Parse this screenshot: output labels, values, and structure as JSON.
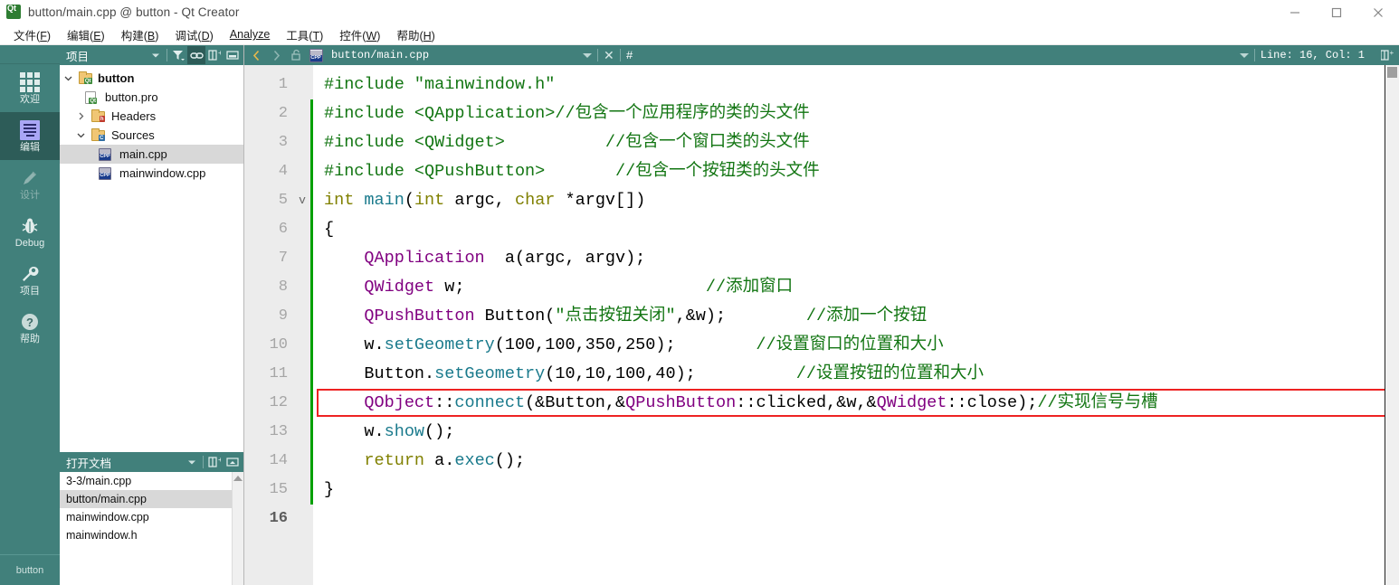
{
  "window": {
    "title": "button/main.cpp @ button - Qt Creator",
    "app_icon": "qt-icon",
    "controls": [
      {
        "name": "minimize-button",
        "glyph": "minimize"
      },
      {
        "name": "maximize-button",
        "glyph": "maximize"
      },
      {
        "name": "close-button",
        "glyph": "close"
      }
    ]
  },
  "menubar": {
    "items": [
      {
        "label": "文件",
        "accel": "F"
      },
      {
        "label": "编辑",
        "accel": "E"
      },
      {
        "label": "构建",
        "accel": "B"
      },
      {
        "label": "调试",
        "accel": "D"
      },
      {
        "label": "Analyze",
        "accel": "A",
        "accel_inline": true
      },
      {
        "label": "工具",
        "accel": "T"
      },
      {
        "label": "控件",
        "accel": "W"
      },
      {
        "label": "帮助",
        "accel": "H"
      }
    ]
  },
  "modebar": {
    "items": [
      {
        "label": "欢迎",
        "icon": "grid-icon",
        "active": false,
        "dim": false
      },
      {
        "label": "编辑",
        "icon": "document-icon",
        "active": true,
        "dim": false
      },
      {
        "label": "设计",
        "icon": "pencil-icon",
        "active": false,
        "dim": true
      },
      {
        "label": "Debug",
        "icon": "bug-icon",
        "active": false,
        "dim": false
      },
      {
        "label": "项目",
        "icon": "wrench-icon",
        "active": false,
        "dim": false
      },
      {
        "label": "帮助",
        "icon": "question-icon",
        "active": false,
        "dim": false
      }
    ],
    "bottom_label": "button"
  },
  "project_panel": {
    "title": "项目",
    "toolbar": [
      {
        "name": "project-selector-dropdown",
        "icon": "chevron-down-icon"
      },
      {
        "name": "filter-button",
        "icon": "filter-icon"
      },
      {
        "name": "link-with-editor-button",
        "icon": "link-icon",
        "active": true
      },
      {
        "name": "split-button",
        "icon": "split-icon"
      },
      {
        "name": "close-panel-button",
        "icon": "minimize-panel-icon"
      }
    ],
    "tree": [
      {
        "label": "button",
        "depth": 0,
        "arrow": "down",
        "icon": "folder-qt",
        "bold": true,
        "selected": false
      },
      {
        "label": "button.pro",
        "depth": 1,
        "arrow": "none",
        "icon": "file-qt",
        "bold": false,
        "selected": false
      },
      {
        "label": "Headers",
        "depth": 1,
        "arrow": "right",
        "icon": "folder-h",
        "bold": false,
        "selected": false
      },
      {
        "label": "Sources",
        "depth": 1,
        "arrow": "down",
        "icon": "folder-cpp",
        "bold": false,
        "selected": false
      },
      {
        "label": "main.cpp",
        "depth": 2,
        "arrow": "none",
        "icon": "file-cpp",
        "bold": false,
        "selected": true
      },
      {
        "label": "mainwindow.cpp",
        "depth": 2,
        "arrow": "none",
        "icon": "file-cpp",
        "bold": false,
        "selected": false
      }
    ]
  },
  "open_documents": {
    "title": "打开文档",
    "toolbar": [
      {
        "name": "opendocs-dropdown",
        "icon": "chevron-down-icon"
      },
      {
        "name": "opendocs-split-button",
        "icon": "split-icon"
      },
      {
        "name": "opendocs-close-button",
        "icon": "minimize-panel-icon"
      }
    ],
    "items": [
      {
        "label": "3-3/main.cpp",
        "selected": false
      },
      {
        "label": "button/main.cpp",
        "selected": true
      },
      {
        "label": "mainwindow.cpp",
        "selected": false
      },
      {
        "label": "mainwindow.h",
        "selected": false
      }
    ]
  },
  "editor_toolbar": {
    "back_icon": "chevron-left-icon",
    "forward_icon": "chevron-right-icon",
    "lock_icon": "unlock-icon",
    "file_icon": "file-cpp-icon",
    "filename": "button/main.cpp",
    "dropdown_icon": "chevron-down-icon",
    "close_icon": "close-icon",
    "symbol_label": "#",
    "line_col": "Line: 16, Col: 1",
    "split_icon": "split-icon"
  },
  "editor": {
    "gutter": {
      "numbers": [
        "1",
        "2",
        "3",
        "4",
        "5",
        "6",
        "7",
        "8",
        "9",
        "10",
        "11",
        "12",
        "13",
        "14",
        "15",
        "16"
      ],
      "current_line": 16,
      "fold_markers": {
        "5": "v"
      },
      "change_bar_lines": [
        2,
        3,
        4,
        5,
        6,
        7,
        8,
        9,
        10,
        11,
        12,
        13,
        14,
        15
      ]
    },
    "highlight_box_line": 12,
    "highlight_box_color": "#ee2222",
    "lines": [
      {
        "n": 1,
        "tokens": [
          {
            "t": "pre",
            "v": "#include "
          },
          {
            "t": "str",
            "v": "\"mainwindow.h\""
          }
        ]
      },
      {
        "n": 2,
        "tokens": [
          {
            "t": "pre",
            "v": "#include "
          },
          {
            "t": "str",
            "v": "<QApplication>"
          },
          {
            "t": "cmt",
            "v": "//包含一个应用程序的类的头文件"
          }
        ]
      },
      {
        "n": 3,
        "tokens": [
          {
            "t": "pre",
            "v": "#include "
          },
          {
            "t": "str",
            "v": "<QWidget>"
          },
          {
            "t": "cmt",
            "v": "          //包含一个窗口类的头文件"
          }
        ]
      },
      {
        "n": 4,
        "tokens": [
          {
            "t": "pre",
            "v": "#include "
          },
          {
            "t": "str",
            "v": "<QPushButton>"
          },
          {
            "t": "cmt",
            "v": "       //包含一个按钮类的头文件"
          }
        ]
      },
      {
        "n": 5,
        "tokens": [
          {
            "t": "kw",
            "v": "int "
          },
          {
            "t": "fn",
            "v": "main"
          },
          {
            "t": "plain",
            "v": "("
          },
          {
            "t": "kw",
            "v": "int "
          },
          {
            "t": "plain",
            "v": "argc, "
          },
          {
            "t": "kw",
            "v": "char "
          },
          {
            "t": "plain",
            "v": "*argv[])"
          }
        ]
      },
      {
        "n": 6,
        "tokens": [
          {
            "t": "plain",
            "v": "{"
          }
        ]
      },
      {
        "n": 7,
        "tokens": [
          {
            "t": "plain",
            "v": "    "
          },
          {
            "t": "type",
            "v": "QApplication"
          },
          {
            "t": "plain",
            "v": "  a(argc, argv);"
          }
        ]
      },
      {
        "n": 8,
        "tokens": [
          {
            "t": "plain",
            "v": "    "
          },
          {
            "t": "type",
            "v": "QWidget"
          },
          {
            "t": "plain",
            "v": " w;"
          },
          {
            "t": "cmt",
            "v": "                        //添加窗口"
          }
        ]
      },
      {
        "n": 9,
        "tokens": [
          {
            "t": "plain",
            "v": "    "
          },
          {
            "t": "type",
            "v": "QPushButton"
          },
          {
            "t": "plain",
            "v": " Button("
          },
          {
            "t": "str",
            "v": "\"点击按钮关闭\""
          },
          {
            "t": "plain",
            "v": ",&w);"
          },
          {
            "t": "cmt",
            "v": "        //添加一个按钮"
          }
        ]
      },
      {
        "n": 10,
        "tokens": [
          {
            "t": "plain",
            "v": "    w."
          },
          {
            "t": "fn",
            "v": "setGeometry"
          },
          {
            "t": "plain",
            "v": "(100,100,350,250);"
          },
          {
            "t": "cmt",
            "v": "        //设置窗口的位置和大小"
          }
        ]
      },
      {
        "n": 11,
        "tokens": [
          {
            "t": "plain",
            "v": "    Button."
          },
          {
            "t": "fn",
            "v": "setGeometry"
          },
          {
            "t": "plain",
            "v": "(10,10,100,40);"
          },
          {
            "t": "cmt",
            "v": "          //设置按钮的位置和大小"
          }
        ]
      },
      {
        "n": 12,
        "tokens": [
          {
            "t": "plain",
            "v": "    "
          },
          {
            "t": "type",
            "v": "QObject"
          },
          {
            "t": "plain",
            "v": "::"
          },
          {
            "t": "fn",
            "v": "connect"
          },
          {
            "t": "plain",
            "v": "(&Button,&"
          },
          {
            "t": "type",
            "v": "QPushButton"
          },
          {
            "t": "plain",
            "v": "::clicked,&w,&"
          },
          {
            "t": "type",
            "v": "QWidget"
          },
          {
            "t": "plain",
            "v": "::close);"
          },
          {
            "t": "cmt",
            "v": "//实现信号与槽"
          }
        ]
      },
      {
        "n": 13,
        "tokens": [
          {
            "t": "plain",
            "v": "    w."
          },
          {
            "t": "fn",
            "v": "show"
          },
          {
            "t": "plain",
            "v": "();"
          }
        ]
      },
      {
        "n": 14,
        "tokens": [
          {
            "t": "plain",
            "v": "    "
          },
          {
            "t": "kw",
            "v": "return "
          },
          {
            "t": "plain",
            "v": "a."
          },
          {
            "t": "fn",
            "v": "exec"
          },
          {
            "t": "plain",
            "v": "();"
          }
        ]
      },
      {
        "n": 15,
        "tokens": [
          {
            "t": "plain",
            "v": "}"
          }
        ]
      },
      {
        "n": 16,
        "tokens": [
          {
            "t": "plain",
            "v": ""
          }
        ]
      }
    ]
  },
  "colors": {
    "teal": "#41807b",
    "teal_active": "#2d5c58",
    "comment_green": "#127512",
    "keyword_olive": "#808000",
    "type_purple": "#800080",
    "function_teal": "#1a7a8c",
    "highlight_red": "#ee2222",
    "gutter_bg": "#ececec",
    "change_bar_green": "#00a000"
  }
}
